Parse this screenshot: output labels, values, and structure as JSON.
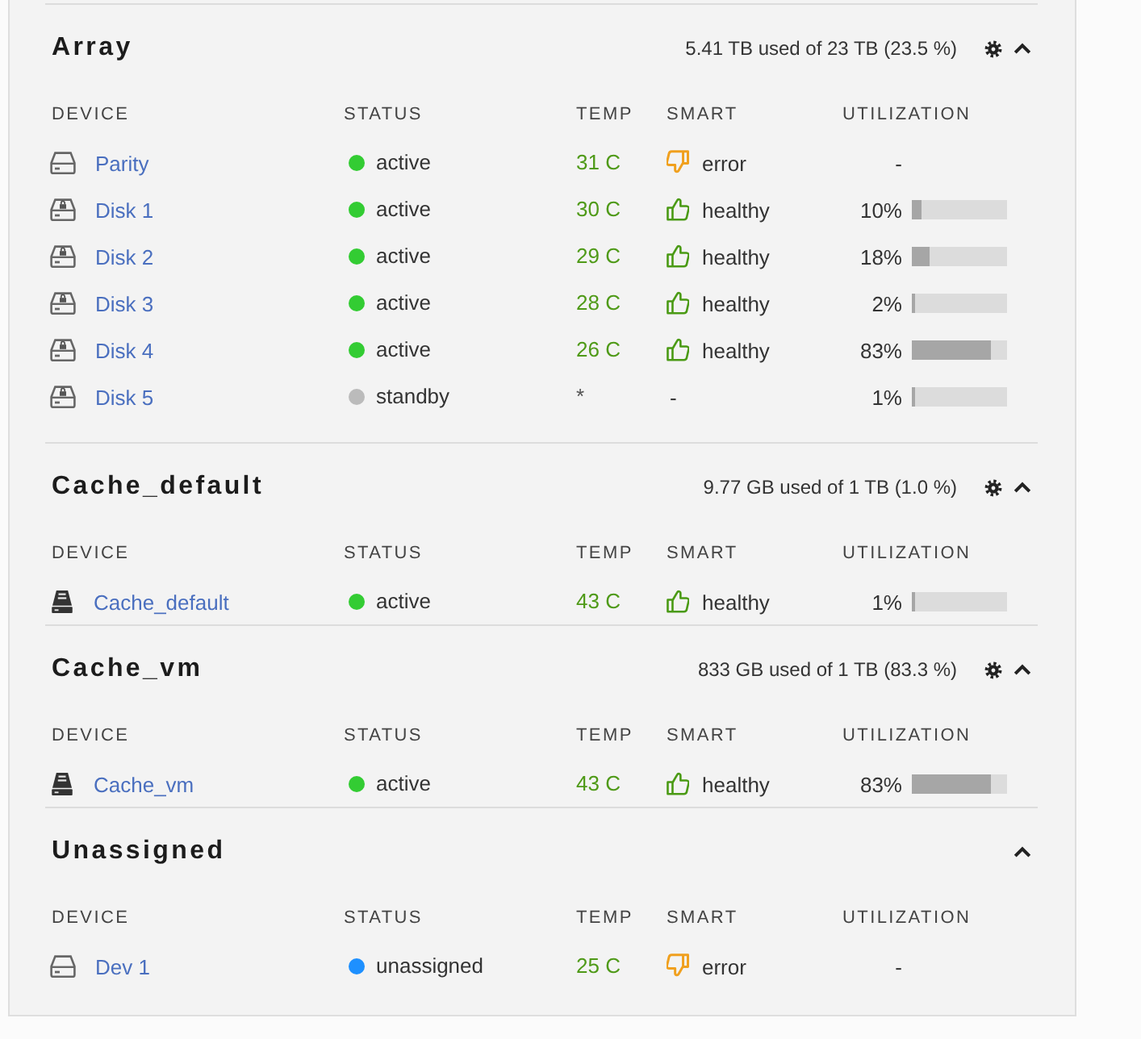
{
  "sections": [
    {
      "title": "Array",
      "usage": "5.41 TB used of 23 TB (23.5 %)",
      "settings": true,
      "expanded": true,
      "columns": [
        "DEVICE",
        "STATUS",
        "TEMP",
        "SMART",
        "UTILIZATION"
      ],
      "rows": [
        {
          "kind": "parity",
          "name": "Parity",
          "status": {
            "text": "active",
            "color": "#33cc33"
          },
          "temp": {
            "kind": "reading",
            "text": "31 C"
          },
          "smart": {
            "kind": "error",
            "text": "error"
          },
          "utilization": {
            "text": "-"
          }
        },
        {
          "kind": "data",
          "name": "Disk 1",
          "status": {
            "text": "active",
            "color": "#33cc33"
          },
          "temp": {
            "kind": "reading",
            "text": "30 C"
          },
          "smart": {
            "kind": "healthy",
            "text": "healthy"
          },
          "utilization": {
            "text": "10%",
            "level": 0.1
          }
        },
        {
          "kind": "data",
          "name": "Disk 2",
          "status": {
            "text": "active",
            "color": "#33cc33"
          },
          "temp": {
            "kind": "reading",
            "text": "29 C"
          },
          "smart": {
            "kind": "healthy",
            "text": "healthy"
          },
          "utilization": {
            "text": "18%",
            "level": 0.18
          }
        },
        {
          "kind": "data",
          "name": "Disk 3",
          "status": {
            "text": "active",
            "color": "#33cc33"
          },
          "temp": {
            "kind": "reading",
            "text": "28 C"
          },
          "smart": {
            "kind": "healthy",
            "text": "healthy"
          },
          "utilization": {
            "text": "2%",
            "level": 0.02
          }
        },
        {
          "kind": "data",
          "name": "Disk 4",
          "status": {
            "text": "active",
            "color": "#33cc33"
          },
          "temp": {
            "kind": "reading",
            "text": "26 C"
          },
          "smart": {
            "kind": "healthy",
            "text": "healthy"
          },
          "utilization": {
            "text": "83%",
            "level": 0.83
          }
        },
        {
          "kind": "data",
          "name": "Disk 5",
          "status": {
            "text": "standby",
            "color": "#bbbbbb"
          },
          "temp": {
            "kind": "unknown",
            "text": "*"
          },
          "smart": {
            "kind": "none",
            "text": "-"
          },
          "utilization": {
            "text": "1%",
            "level": 0.01
          }
        }
      ]
    },
    {
      "title": "Cache_default",
      "usage": "9.77 GB used of 1 TB (1.0 %)",
      "settings": true,
      "expanded": true,
      "columns": [
        "DEVICE",
        "STATUS",
        "TEMP",
        "SMART",
        "UTILIZATION"
      ],
      "rows": [
        {
          "kind": "pool",
          "name": "Cache_default",
          "status": {
            "text": "active",
            "color": "#33cc33"
          },
          "temp": {
            "kind": "reading",
            "text": "43 C"
          },
          "smart": {
            "kind": "healthy",
            "text": "healthy"
          },
          "utilization": {
            "text": "1%",
            "level": 0.01
          }
        }
      ]
    },
    {
      "title": "Cache_vm",
      "usage": "833 GB used of 1 TB (83.3 %)",
      "settings": true,
      "expanded": true,
      "columns": [
        "DEVICE",
        "STATUS",
        "TEMP",
        "SMART",
        "UTILIZATION"
      ],
      "rows": [
        {
          "kind": "pool",
          "name": "Cache_vm",
          "status": {
            "text": "active",
            "color": "#33cc33"
          },
          "temp": {
            "kind": "reading",
            "text": "43 C"
          },
          "smart": {
            "kind": "healthy",
            "text": "healthy"
          },
          "utilization": {
            "text": "83%",
            "level": 0.83
          }
        }
      ]
    },
    {
      "title": "Unassigned",
      "settings": false,
      "expanded": true,
      "columns": [
        "DEVICE",
        "STATUS",
        "TEMP",
        "SMART",
        "UTILIZATION"
      ],
      "rows": [
        {
          "kind": "unassigned",
          "name": "Dev 1",
          "status": {
            "text": "unassigned",
            "color": "#1e90ff"
          },
          "temp": {
            "kind": "reading",
            "text": "25 C"
          },
          "smart": {
            "kind": "error",
            "text": "error"
          },
          "utilization": {
            "text": "-"
          }
        }
      ]
    }
  ]
}
